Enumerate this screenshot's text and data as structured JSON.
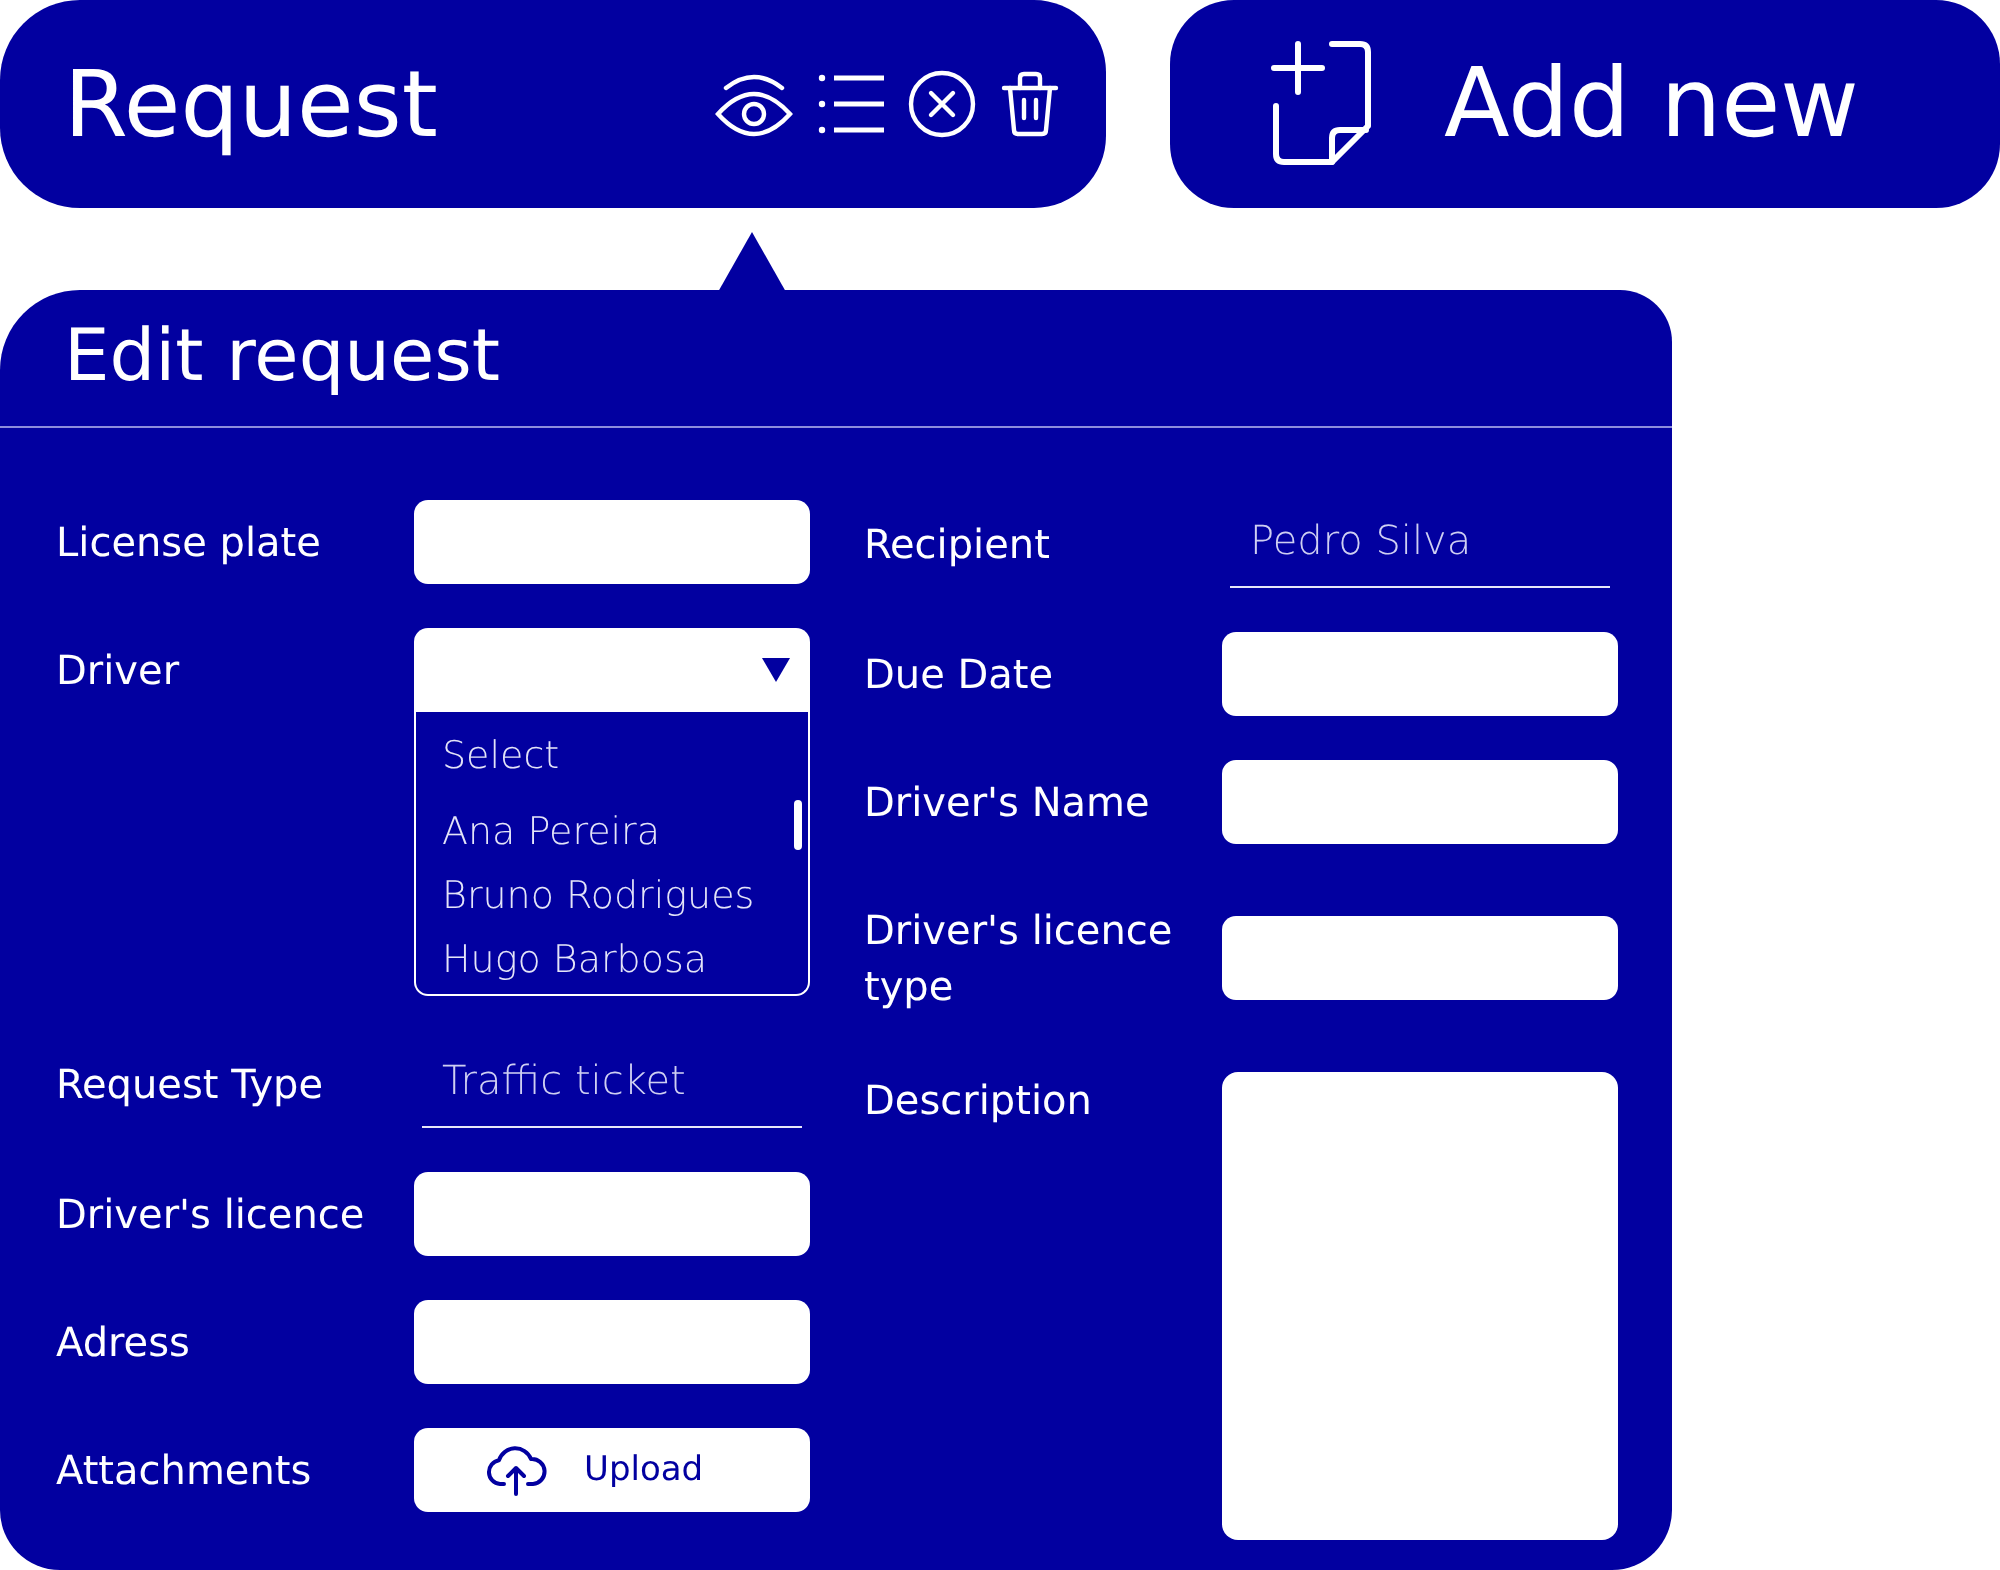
{
  "request_bar": {
    "title": "Request"
  },
  "add_button": {
    "label": "Add new"
  },
  "edit_panel": {
    "title": "Edit request",
    "left_fields": [
      {
        "label": "License plate",
        "kind": "text"
      },
      {
        "label": "Driver",
        "kind": "select",
        "expanded": true,
        "options": [
          {
            "label": "Select",
            "kind": "placeholder"
          },
          {
            "label": "Ana Pereira",
            "kind": "option"
          },
          {
            "label": "Bruno Rodrigues",
            "kind": "option"
          },
          {
            "label": "Hugo Barbosa",
            "kind": "option"
          }
        ]
      },
      {
        "label": "Request Type",
        "kind": "underline",
        "value": "Traffic ticket"
      },
      {
        "label": "Driver's licence",
        "kind": "text"
      },
      {
        "label": "Adress",
        "kind": "text"
      },
      {
        "label": "Attachments",
        "kind": "upload",
        "button": "Upload"
      }
    ],
    "right_fields": [
      {
        "label": "Recipient",
        "kind": "underline",
        "value": "Pedro Silva"
      },
      {
        "label": "Due Date",
        "kind": "text"
      },
      {
        "label": "Driver's Name",
        "kind": "text"
      },
      {
        "label": "Driver's licence type",
        "kind": "text"
      },
      {
        "label": "Description",
        "kind": "textarea"
      }
    ]
  }
}
